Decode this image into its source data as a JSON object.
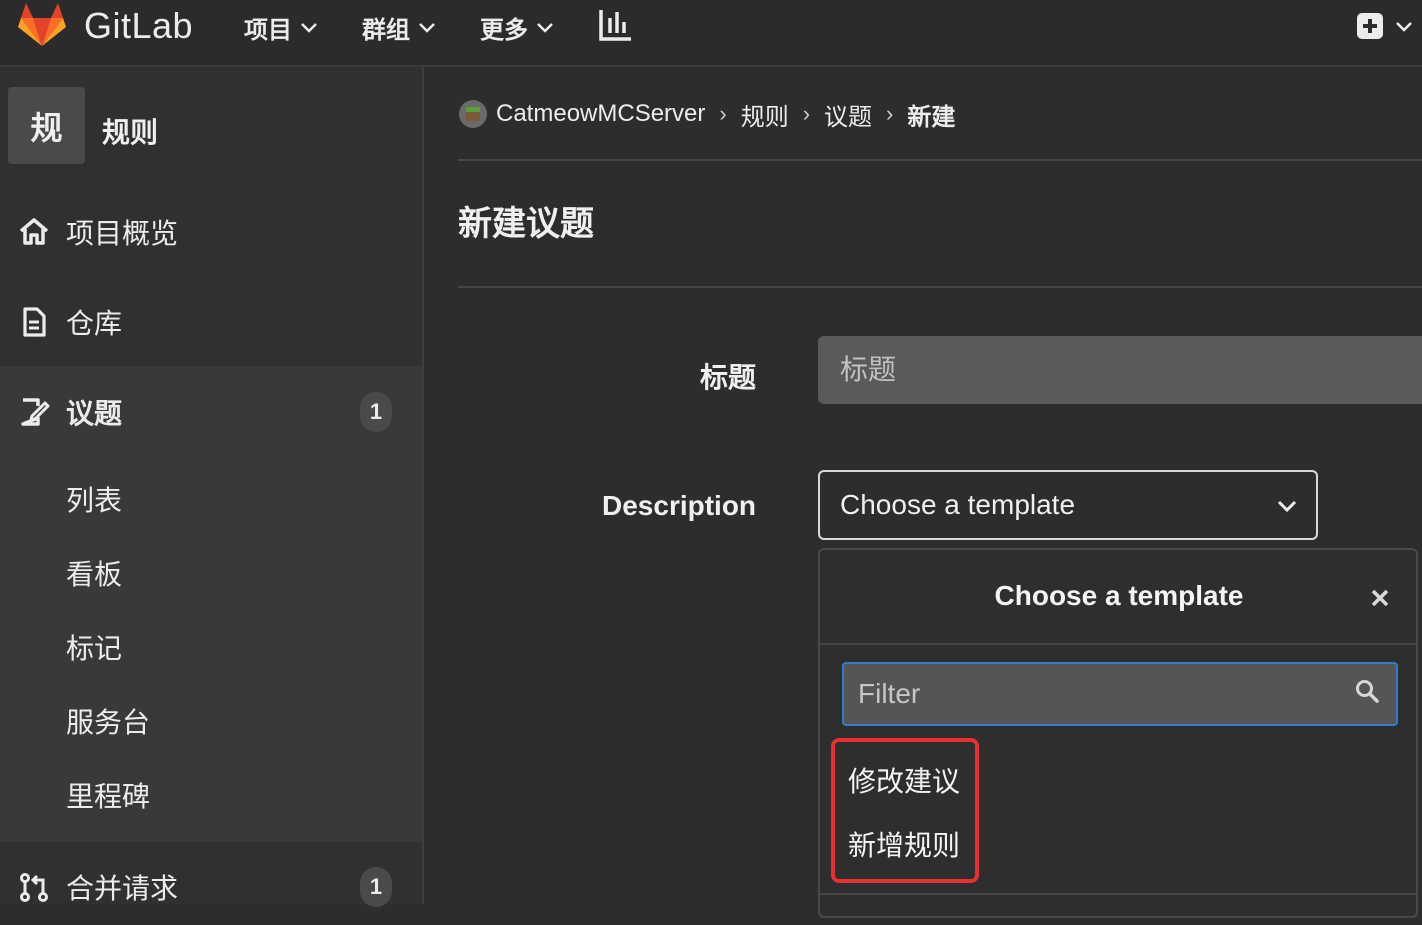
{
  "topnav": {
    "brand": "GitLab",
    "items": [
      {
        "label": "项目"
      },
      {
        "label": "群组"
      },
      {
        "label": "更多"
      }
    ]
  },
  "sidebar": {
    "project_avatar": "规",
    "project_name": "规则",
    "items": [
      {
        "label": "项目概览",
        "icon": "home-icon"
      },
      {
        "label": "仓库",
        "icon": "document-icon"
      },
      {
        "label": "议题",
        "icon": "issues-icon",
        "count": "1",
        "active": true
      },
      {
        "label": "合并请求",
        "icon": "merge-request-icon",
        "count": "1"
      }
    ],
    "issue_sub_items": [
      "列表",
      "看板",
      "标记",
      "服务台",
      "里程碑"
    ]
  },
  "breadcrumb": {
    "items": [
      "CatmeowMCServer",
      "规则",
      "议题"
    ],
    "current": "新建"
  },
  "page": {
    "title": "新建议题",
    "form": {
      "title_label": "标题",
      "title_placeholder": "标题",
      "description_label": "Description",
      "template_select_value": "Choose a template"
    }
  },
  "template_dropdown": {
    "header": "Choose a template",
    "filter_placeholder": "Filter",
    "options": [
      "修改建议",
      "新增规则"
    ]
  },
  "colors": {
    "background": "#2d2d2d",
    "sidebar": "#303030",
    "filter_focus": "#2f7cd0",
    "highlight": "#e83030"
  }
}
